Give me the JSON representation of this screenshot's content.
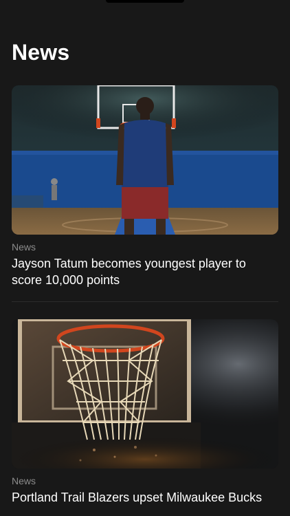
{
  "header": {
    "title": "News"
  },
  "articles": [
    {
      "category": "News",
      "headline": "Jayson Tatum becomes youngest player to score 10,000 points",
      "image_icon": "basketball-player-photo"
    },
    {
      "category": "News",
      "headline": "Portland Trail Blazers upset Milwaukee Bucks",
      "image_icon": "basketball-hoop-photo"
    }
  ],
  "colors": {
    "background": "#181818",
    "category_text": "#8c8c8c",
    "headline_text": "#ffffff",
    "court_blue": "#1d4f9a",
    "rim_orange": "#d1461e"
  }
}
